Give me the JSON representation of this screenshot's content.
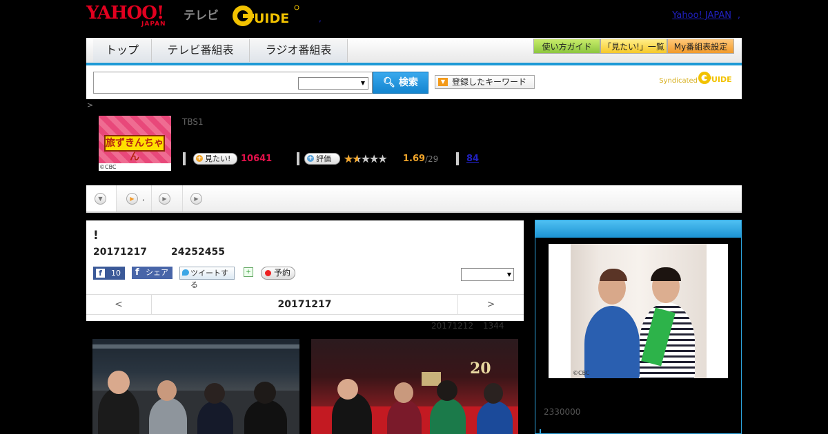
{
  "header": {
    "yahoo_logo": "YAHOO!",
    "yahoo_japan": "JAPAN",
    "tv_label": "テレビ",
    "gguide_logo": "G GUIDE",
    "top_link": "Yahoo! JAPAN",
    "link_dot": ",",
    "small_dot": ","
  },
  "nav": {
    "tabs": [
      "トップ",
      "テレビ番組表",
      "ラジオ番組表"
    ],
    "buttons": [
      "使い方ガイド",
      "「見たい!」一覧",
      "My番組表設定"
    ]
  },
  "search": {
    "placeholder": "",
    "button_label": "検索",
    "keyword_button": "登録したキーワード",
    "syndicated": "Syndicated"
  },
  "breadcrumb": ">",
  "program": {
    "thumb_title": "旅ずきんちゃん",
    "thumb_credit": "©CBC",
    "channel": "TBS1",
    "want_label": "見たい!",
    "want_count": "10641",
    "rate_label": "評価",
    "stars": "★★★★★",
    "rating_fraction": 0.338,
    "rating": "1.69",
    "rating_count": "/29",
    "review_count": "84"
  },
  "subtabs": {
    "item2_suffix": ","
  },
  "card": {
    "title": "!",
    "date": "20171217",
    "time": "24252455",
    "fb_count": "10",
    "fb_share": "シェア",
    "tweet": "ツイートする",
    "reserve": "予約",
    "nav_prev": "<",
    "nav_next": ">",
    "nav_date": "20171217"
  },
  "update": {
    "date": "20171212",
    "time": "1344"
  },
  "sidebar": {
    "credit": "©CBC",
    "text": "2330000"
  },
  "colors": {
    "accent": "#1e9ad6",
    "want": "#e2114a",
    "rating": "#f2a52a",
    "link": "#2020c0"
  }
}
